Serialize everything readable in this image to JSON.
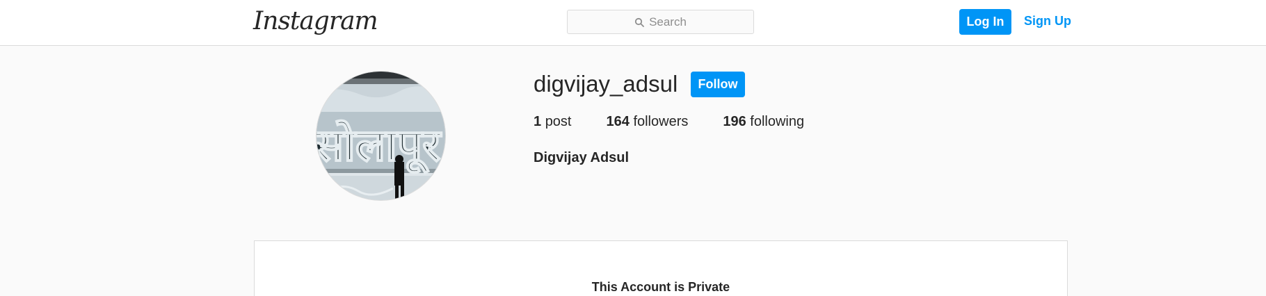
{
  "header": {
    "logo_text": "Instagram",
    "search": {
      "placeholder": "Search",
      "icon": "search-icon"
    },
    "login_label": "Log In",
    "signup_label": "Sign Up"
  },
  "profile": {
    "username": "digvijay_adsul",
    "follow_label": "Follow",
    "stats": [
      {
        "count": "1",
        "label": "post"
      },
      {
        "count": "164",
        "label": "followers"
      },
      {
        "count": "196",
        "label": "following"
      }
    ],
    "full_name": "Digvijay Adsul",
    "avatar_sign_text": "सोलापूर"
  },
  "private_notice": {
    "message": "This Account is Private"
  },
  "colors": {
    "accent": "#0095f6",
    "background": "#fafafa",
    "border": "#dbdbdb",
    "text": "#262626",
    "muted": "#8e8e8e"
  }
}
